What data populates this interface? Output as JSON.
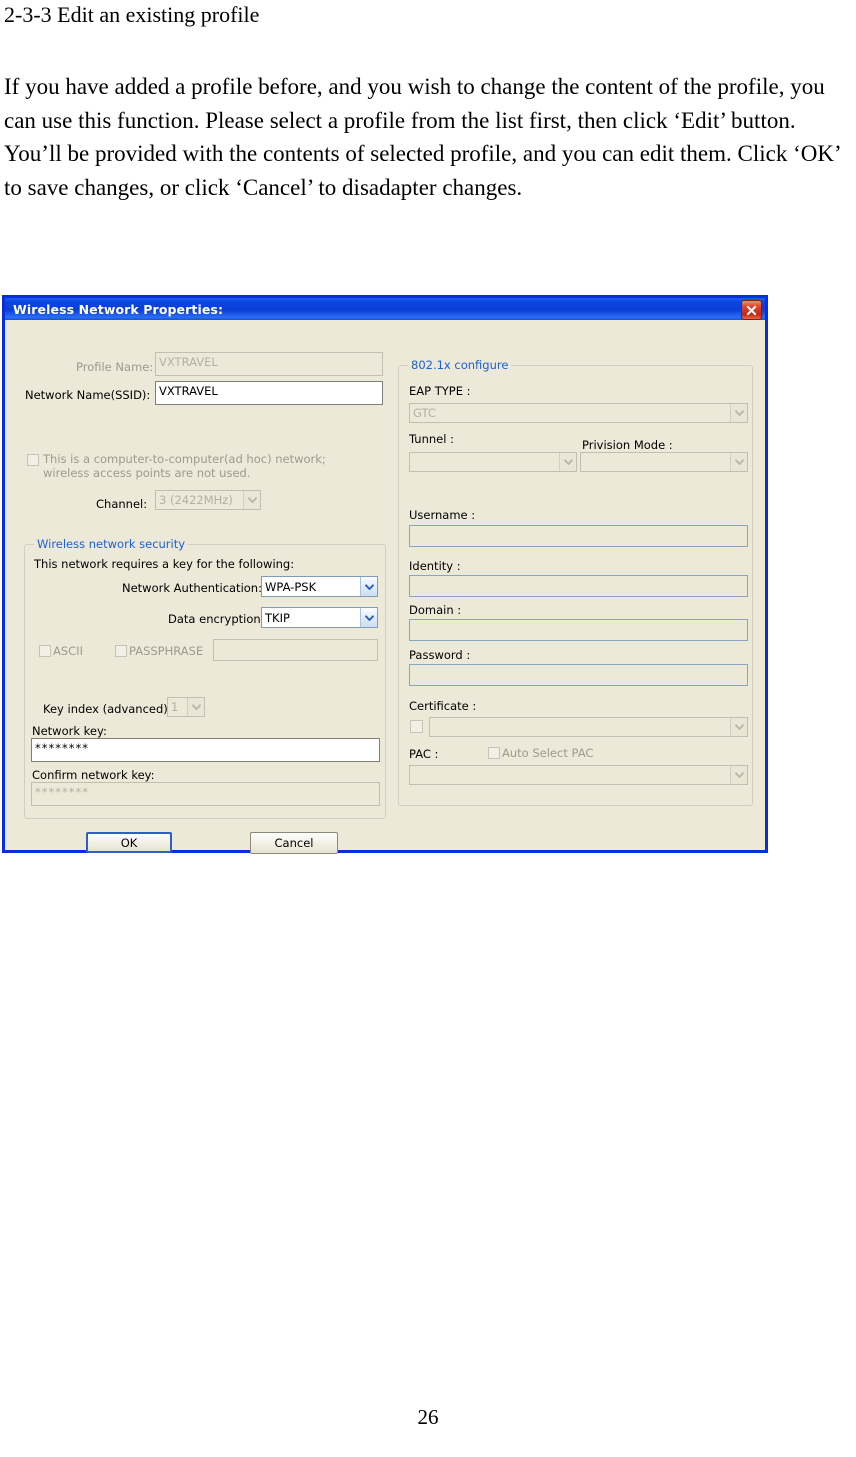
{
  "document": {
    "heading": "2-3-3 Edit an existing profile",
    "paragraph": "If you have added a profile before, and you wish to change the content of the profile, you can use this function. Please select a profile from the list first, then click ‘Edit’ button. You’ll be provided with the contents of selected profile, and you can edit them. Click ‘OK’ to save changes, or click ‘Cancel’ to disadapter changes.",
    "page_number": "26"
  },
  "dialog": {
    "title": "Wireless Network Properties:",
    "close_icon": "close-icon",
    "left": {
      "profile_name_label": "Profile Name:",
      "profile_name_value": "VXTRAVEL",
      "ssid_label": "Network Name(SSID):",
      "ssid_value": "VXTRAVEL",
      "adhoc_label": "This is a computer-to-computer(ad hoc) network; wireless access points are not used.",
      "channel_label": "Channel:",
      "channel_value": "3  (2422MHz)",
      "security_group_title": "Wireless network security",
      "security_intro": "This network requires a key for the following:",
      "network_auth_label": "Network Authentication:",
      "network_auth_value": "WPA-PSK",
      "data_encryption_label": "Data encryption:",
      "data_encryption_value": "TKIP",
      "ascii_label": "ASCII",
      "passphrase_label": "PASSPHRASE",
      "passphrase_value": "",
      "key_index_label": "Key index (advanced):",
      "key_index_value": "1",
      "network_key_label": "Network key:",
      "network_key_value": "********",
      "confirm_key_label": "Confirm network key:",
      "confirm_key_value": "********"
    },
    "right": {
      "group_title": "802.1x configure",
      "eap_type_label": "EAP TYPE :",
      "eap_type_value": "GTC",
      "tunnel_label": "Tunnel :",
      "tunnel_value": "",
      "provision_mode_label": "Privision Mode :",
      "provision_mode_value": "",
      "username_label": "Username :",
      "username_value": "",
      "identity_label": "Identity :",
      "identity_value": "",
      "domain_label": "Domain :",
      "domain_value": "",
      "password_label": "Password :",
      "password_value": "",
      "certificate_label": "Certificate :",
      "certificate_value": "",
      "pac_label": "PAC :",
      "auto_select_pac_label": "Auto Select PAC",
      "pac_value": ""
    },
    "buttons": {
      "ok": "OK",
      "cancel": "Cancel"
    }
  },
  "colors": {
    "titlebar_blue": "#0b45e0",
    "window_border": "#0a2ddd",
    "dialog_bg": "#ece9d8",
    "group_title_blue": "#1f5fd0",
    "close_red": "#c42612"
  }
}
